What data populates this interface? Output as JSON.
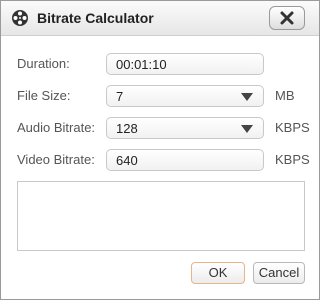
{
  "window": {
    "title": "Bitrate Calculator",
    "icon": "film-reel-icon",
    "close_icon": "close-icon"
  },
  "form": {
    "duration": {
      "label": "Duration:",
      "value": "00:01:10"
    },
    "file_size": {
      "label": "File Size:",
      "value": "7",
      "unit": "MB"
    },
    "audio_bitrate": {
      "label": "Audio Bitrate:",
      "value": "128",
      "unit": "KBPS"
    },
    "video_bitrate": {
      "label": "Video Bitrate:",
      "value": "640",
      "unit": "KBPS"
    },
    "notes": {
      "value": ""
    }
  },
  "buttons": {
    "ok": "OK",
    "cancel": "Cancel"
  },
  "colors": {
    "ok_border": "#e8b48a",
    "field_border": "#c9c9c9"
  }
}
